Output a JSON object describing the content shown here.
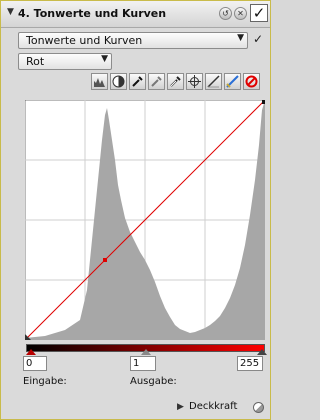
{
  "panel": {
    "title": "4. Tonwerte und Kurven",
    "collapse_icon": "triangle-down-icon",
    "buttons": [
      "reset-icon",
      "close-icon"
    ],
    "enabled_check": "✓"
  },
  "mode_dropdown": {
    "value": "Tonwerte und Kurven",
    "checked": "✓"
  },
  "channel_dropdown": {
    "value": "Rot"
  },
  "tools": [
    "histogram-icon",
    "contrast-icon",
    "black-eyedropper-icon",
    "gray-eyedropper-icon",
    "white-eyedropper-icon",
    "target-icon",
    "linear-curve-icon",
    "pencil-curve-icon",
    "reset-red-icon"
  ],
  "curve": {
    "channel_color": "#e00000",
    "points": [
      [
        0,
        0
      ],
      [
        68,
        68
      ],
      [
        255,
        255
      ]
    ]
  },
  "histogram": {
    "color": "#a7a7a7"
  },
  "levels": {
    "black_point": "0",
    "gamma": "1",
    "white_point": "255"
  },
  "labels": {
    "input": "Eingabe:",
    "output": "Ausgabe:"
  },
  "footer": {
    "label": "Deckkraft",
    "arrow": "▶"
  }
}
